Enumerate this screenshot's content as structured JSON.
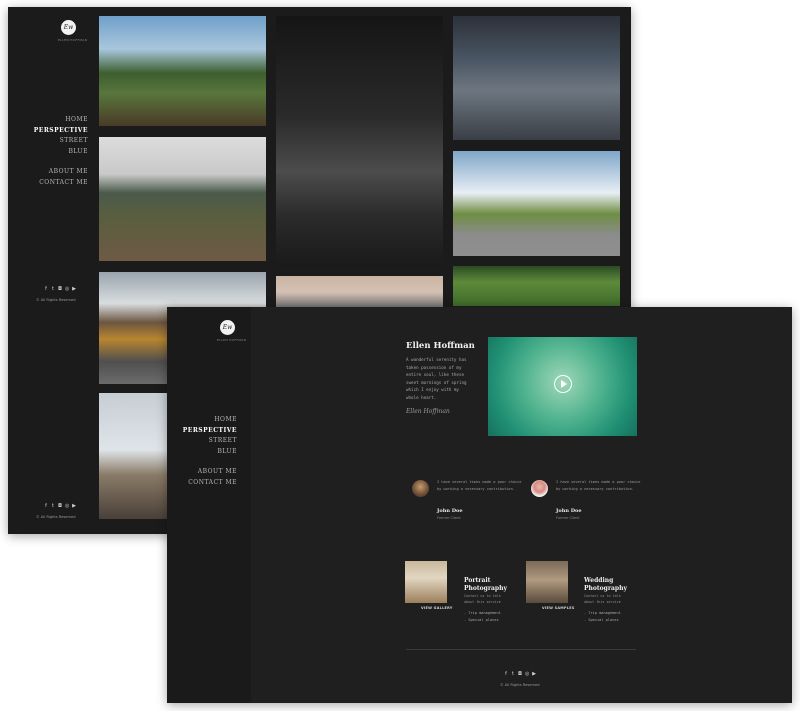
{
  "brand": {
    "logo_text": "Ew",
    "caption": "ELLEN HOFFMAN"
  },
  "nav": {
    "home": "HOME",
    "perspective": "PERSPECTIVE",
    "street": "STREET",
    "blue": "BLUE",
    "about": "ABOUT ME",
    "contact": "CONTACT ME"
  },
  "footer": {
    "rights": "© All Rights Reserved",
    "social_icons": [
      "facebook-icon",
      "twitter-icon",
      "instagram-icon",
      "camera-icon",
      "youtube-icon"
    ]
  },
  "social_glyphs": [
    "f",
    "t",
    "◘",
    "◎",
    "▶"
  ],
  "about": {
    "name": "Ellen Hoffman",
    "bio": "A wonderful serenity has taken possession of my entire soul, like these sweet mornings of spring which I enjoy with my whole heart.",
    "signature": "Ellen Hoffman"
  },
  "testimonials": [
    {
      "quote": "I have several times made a poor choice by working a necessary contribution.",
      "name": "John Doe",
      "role": "Former Client"
    },
    {
      "quote": "I have several times made a poor choice by working a necessary contribution.",
      "name": "John Doe",
      "role": "Former Client"
    }
  ],
  "services": [
    {
      "title_line1": "Portrait",
      "title_line2": "Photography",
      "desc": "Contact us to talk about this service",
      "cta": "VIEW GALLERY",
      "items": [
        "- Trip management",
        "- Special places"
      ]
    },
    {
      "title_line1": "Wedding",
      "title_line2": "Photography",
      "desc": "Contact us to talk about this service",
      "cta": "VIEW SAMPLES",
      "items": [
        "- Trip management",
        "- Special places"
      ]
    }
  ]
}
